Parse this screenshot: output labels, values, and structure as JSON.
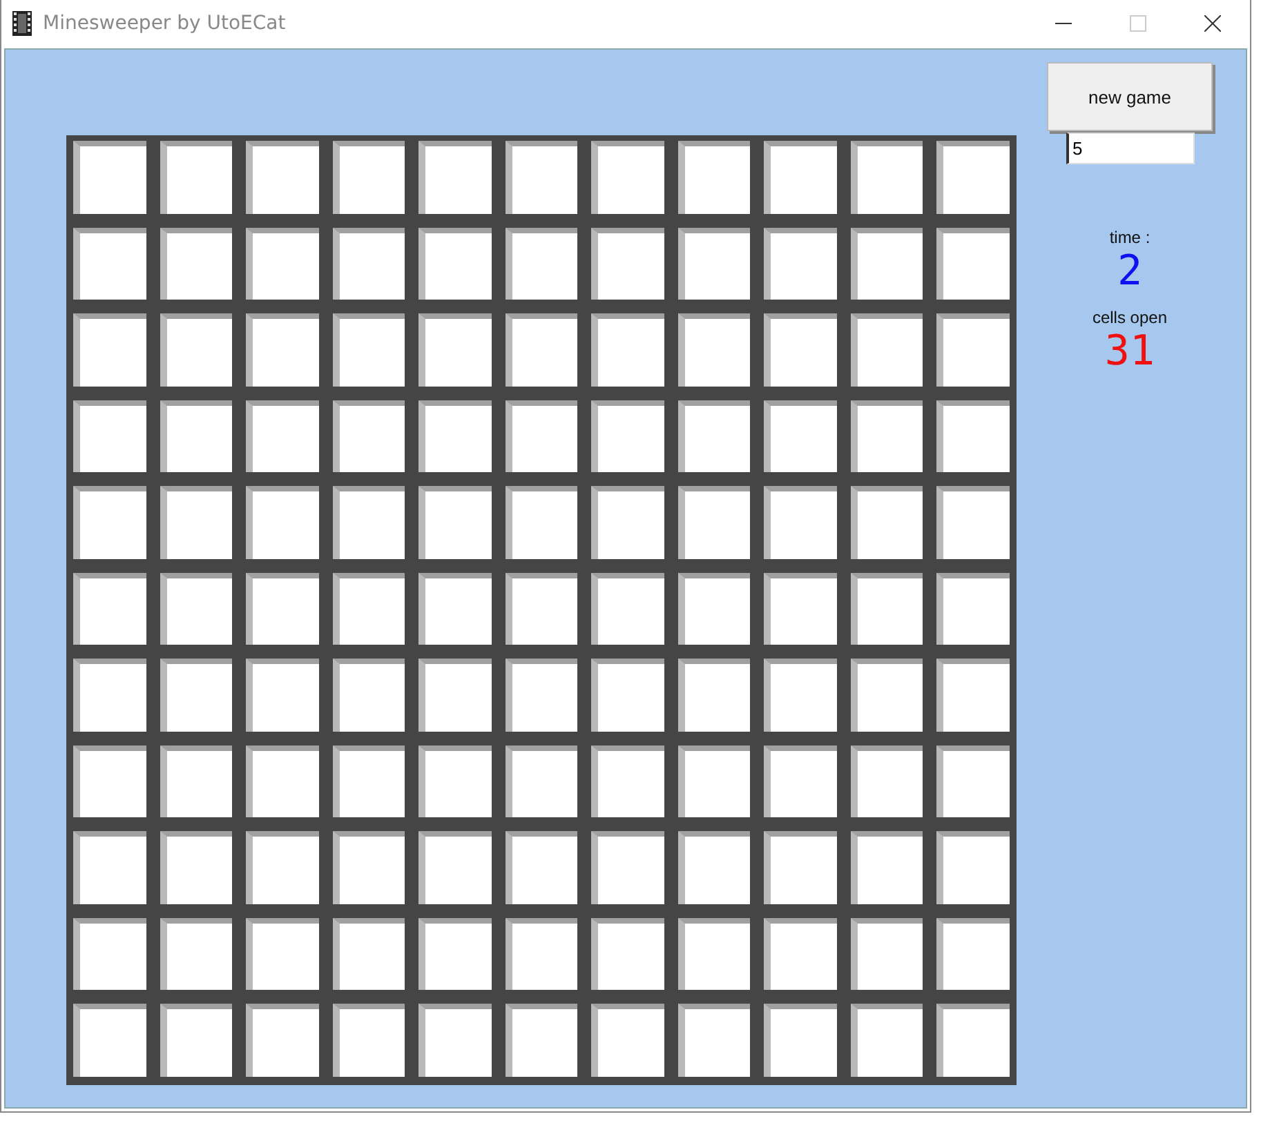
{
  "window": {
    "title": "Minesweeper by UtoECat"
  },
  "controls": {
    "new_game_button": "new game",
    "count_field": "5"
  },
  "stats": [
    {
      "label": "time :",
      "value": "2",
      "color": "#1010f0"
    },
    {
      "label": "cells open",
      "value": "31",
      "color": "#f01010"
    }
  ],
  "grid": {
    "rows": [
      {
        "cells": [
          {
            "kind": "closed"
          },
          {
            "kind": "closed"
          },
          {
            "kind": "closed"
          },
          {
            "kind": "closed"
          },
          {
            "kind": "closed"
          },
          {
            "kind": "closed"
          },
          {
            "kind": "closed"
          },
          {
            "kind": "closed"
          },
          {
            "kind": "closed"
          },
          {
            "kind": "closed"
          },
          {
            "kind": "closed"
          }
        ]
      },
      {
        "cells": [
          {
            "kind": "closed"
          },
          {
            "kind": "closed"
          },
          {
            "kind": "closed"
          },
          {
            "kind": "closed"
          },
          {
            "kind": "closed"
          },
          {
            "kind": "closed"
          },
          {
            "kind": "closed"
          },
          {
            "kind": "closed"
          },
          {
            "kind": "closed"
          },
          {
            "kind": "closed"
          },
          {
            "kind": "closed"
          }
        ]
      },
      {
        "cells": [
          {
            "kind": "closed"
          },
          {
            "kind": "closed"
          },
          {
            "kind": "closed"
          },
          {
            "kind": "closed"
          },
          {
            "kind": "closed"
          },
          {
            "kind": "closed"
          },
          {
            "kind": "closed"
          },
          {
            "kind": "closed"
          },
          {
            "kind": "closed"
          },
          {
            "kind": "closed"
          },
          {
            "kind": "closed"
          }
        ]
      },
      {
        "cells": [
          {
            "kind": "closed"
          },
          {
            "kind": "closed"
          },
          {
            "kind": "closed"
          },
          {
            "kind": "closed"
          },
          {
            "kind": "closed"
          },
          {
            "kind": "closed"
          },
          {
            "kind": "closed"
          },
          {
            "kind": "closed"
          },
          {
            "kind": "closed"
          },
          {
            "kind": "closed"
          },
          {
            "kind": "closed"
          }
        ]
      },
      {
        "cells": [
          {
            "kind": "closed"
          },
          {
            "kind": "closed"
          },
          {
            "kind": "closed"
          },
          {
            "kind": "closed"
          },
          {
            "kind": "closed"
          },
          {
            "kind": "closed"
          },
          {
            "kind": "closed"
          },
          {
            "kind": "closed"
          },
          {
            "kind": "closed"
          },
          {
            "kind": "closed"
          },
          {
            "kind": "closed"
          }
        ]
      },
      {
        "cells": [
          {
            "kind": "closed"
          },
          {
            "kind": "closed"
          },
          {
            "kind": "closed"
          },
          {
            "kind": "closed"
          },
          {
            "kind": "closed"
          },
          {
            "kind": "closed"
          },
          {
            "kind": "closed"
          },
          {
            "kind": "closed"
          },
          {
            "kind": "closed"
          },
          {
            "kind": "closed"
          },
          {
            "kind": "closed"
          }
        ]
      },
      {
        "cells": [
          {
            "kind": "closed"
          },
          {
            "kind": "closed"
          },
          {
            "kind": "closed"
          },
          {
            "kind": "closed"
          },
          {
            "kind": "closed"
          },
          {
            "kind": "closed"
          },
          {
            "kind": "closed"
          },
          {
            "kind": "closed"
          },
          {
            "kind": "closed"
          },
          {
            "kind": "closed"
          },
          {
            "kind": "closed"
          }
        ]
      },
      {
        "cells": [
          {
            "kind": "closed"
          },
          {
            "kind": "closed"
          },
          {
            "kind": "closed"
          },
          {
            "kind": "closed"
          },
          {
            "kind": "closed"
          },
          {
            "kind": "closed"
          },
          {
            "kind": "closed"
          },
          {
            "kind": "closed"
          },
          {
            "kind": "closed"
          },
          {
            "kind": "closed"
          },
          {
            "kind": "closed"
          }
        ]
      },
      {
        "cells": [
          {
            "kind": "closed"
          },
          {
            "kind": "closed"
          },
          {
            "kind": "closed"
          },
          {
            "kind": "closed"
          },
          {
            "kind": "closed"
          },
          {
            "kind": "closed"
          },
          {
            "kind": "closed"
          },
          {
            "kind": "closed"
          },
          {
            "kind": "closed"
          },
          {
            "kind": "closed"
          },
          {
            "kind": "closed"
          }
        ]
      },
      {
        "cells": [
          {
            "kind": "closed"
          },
          {
            "kind": "closed"
          },
          {
            "kind": "closed"
          },
          {
            "kind": "closed"
          },
          {
            "kind": "closed"
          },
          {
            "kind": "closed"
          },
          {
            "kind": "closed"
          },
          {
            "kind": "closed"
          },
          {
            "kind": "closed"
          },
          {
            "kind": "closed"
          },
          {
            "kind": "closed"
          }
        ]
      },
      {
        "cells": [
          {
            "kind": "closed"
          },
          {
            "kind": "closed"
          },
          {
            "kind": "closed"
          },
          {
            "kind": "closed"
          },
          {
            "kind": "closed"
          },
          {
            "kind": "closed"
          },
          {
            "kind": "closed"
          },
          {
            "kind": "closed"
          },
          {
            "kind": "closed"
          },
          {
            "kind": "closed"
          },
          {
            "kind": "closed"
          }
        ]
      }
    ]
  }
}
